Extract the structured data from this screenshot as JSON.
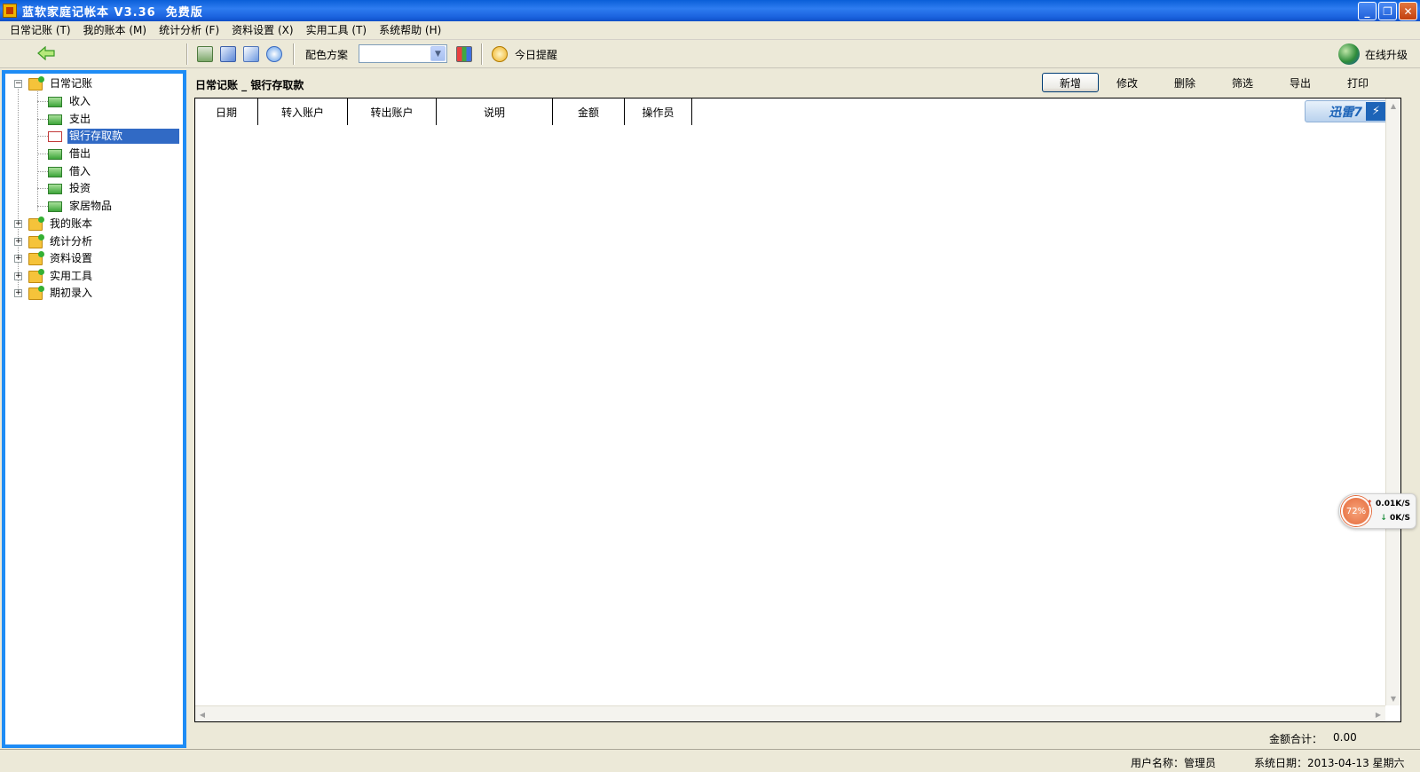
{
  "window": {
    "title": "蓝软家庭记帐本 V3.36  免费版",
    "minimize": "_",
    "restore": "❐",
    "close": "✕"
  },
  "menu": [
    {
      "label": "日常记账 (T)"
    },
    {
      "label": "我的账本 (M)"
    },
    {
      "label": "统计分析 (F)"
    },
    {
      "label": "资料设置 (X)"
    },
    {
      "label": "实用工具 (T)"
    },
    {
      "label": "系统帮助 (H)"
    }
  ],
  "toolbar": {
    "scheme_label": "配色方案",
    "scheme_value": "",
    "reminder_label": "今日提醒",
    "upgrade_label": "在线升级"
  },
  "tree": {
    "root_expanded": {
      "label": "日常记账"
    },
    "children": [
      {
        "label": "收入"
      },
      {
        "label": "支出"
      },
      {
        "label": "银行存取款"
      },
      {
        "label": "借出"
      },
      {
        "label": "借入"
      },
      {
        "label": "投资"
      },
      {
        "label": "家居物品"
      }
    ],
    "collapsed": [
      {
        "label": "我的账本"
      },
      {
        "label": "统计分析"
      },
      {
        "label": "资料设置"
      },
      {
        "label": "实用工具"
      },
      {
        "label": "期初录入"
      }
    ]
  },
  "content": {
    "title": "日常记账 _ 银行存取款",
    "actions": {
      "add": "新增",
      "edit": "修改",
      "delete": "删除",
      "filter": "筛选",
      "export": "导出",
      "print": "打印"
    },
    "columns": [
      "日期",
      "转入账户",
      "转出账户",
      "说明",
      "金额",
      "操作员"
    ],
    "rows": []
  },
  "overlay": {
    "xunlei": "迅雷7",
    "net_percent": "72%",
    "net_up": "0.01K/S",
    "net_down": "0K/S"
  },
  "footer": {
    "total_label": "金额合计：",
    "total_value": "0.00",
    "user": "用户名称：管理员",
    "system_date": "系统日期：2013-04-13  星期六"
  },
  "colors": {
    "title_bar": "#1a62de",
    "panel_border": "#1e8cf5",
    "selection": "#316ac5",
    "chrome": "#ece9d8"
  }
}
